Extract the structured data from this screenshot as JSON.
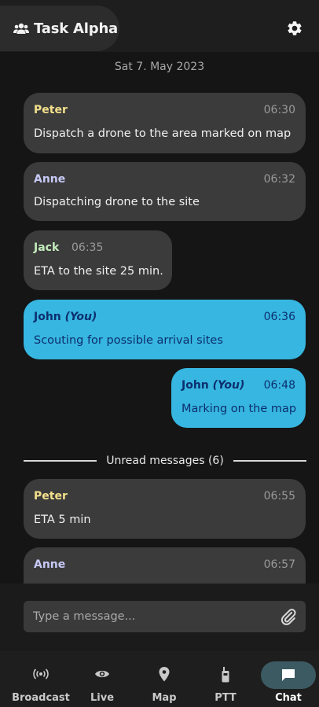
{
  "header": {
    "title": "Task Alpha",
    "title_icon": "group-icon",
    "settings_icon": "gear-icon"
  },
  "date_label": "Sat 7. May 2023",
  "messages": [
    {
      "name": "Peter",
      "time": "06:30",
      "text": "Dispatch a drone to the area marked on map",
      "name_color": "#f3e08c"
    },
    {
      "name": "Anne",
      "time": "06:32",
      "text": "Dispatching drone to the site",
      "name_color": "#c7c9f5"
    },
    {
      "name": "Jack",
      "time": "06:35",
      "text": "ETA to the site 25 min.",
      "name_color": "#c4ecbd"
    },
    {
      "name": "John",
      "you": "(You)",
      "time": "06:36",
      "text": "Scouting for possible arrival sites"
    },
    {
      "name": "John",
      "you": "(You)",
      "time": "06:48",
      "text": "Marking on the map"
    }
  ],
  "unread_label": "Unread messages (6)",
  "unread_messages": [
    {
      "name": "Peter",
      "time": "06:55",
      "text": "ETA 5 min",
      "name_color": "#f3e08c"
    },
    {
      "name": "Anne",
      "time": "06:57",
      "text": "",
      "name_color": "#c7c9f5"
    }
  ],
  "composer": {
    "placeholder": "Type a message...",
    "attach_icon": "paperclip-icon"
  },
  "nav": [
    {
      "label": "Broadcast",
      "icon": "broadcast-icon",
      "active": false
    },
    {
      "label": "Live",
      "icon": "eye-icon",
      "active": false
    },
    {
      "label": "Map",
      "icon": "map-pin-icon",
      "active": false
    },
    {
      "label": "PTT",
      "icon": "walkie-talkie-icon",
      "active": false
    },
    {
      "label": "Chat",
      "icon": "chat-icon",
      "active": true
    }
  ],
  "colors": {
    "background": "#151515",
    "bubble": "#3b3b3b",
    "own_bubble": "#36b6e0",
    "own_text": "#0d2e6e",
    "nav_active": "#3c5a62"
  }
}
